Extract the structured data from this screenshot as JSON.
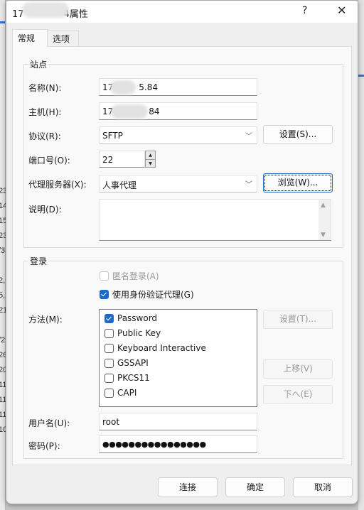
{
  "window": {
    "title_prefix": "17",
    "title_suffix": "4属性",
    "help_label": "?",
    "close_label": "✕"
  },
  "tabs": [
    {
      "label": "常规",
      "active": true
    },
    {
      "label": "选项",
      "active": false
    }
  ],
  "site": {
    "group_label": "站点",
    "name_label": "名称(N):",
    "name_value_prefix": "17",
    "name_value_suffix": "5.84",
    "host_label": "主机(H):",
    "host_value_prefix": "17",
    "host_value_suffix": "84",
    "protocol_label": "协议(R):",
    "protocol_value": "SFTP",
    "protocol_settings_button": "设置(S)...",
    "port_label": "端口号(O):",
    "port_value": "22",
    "proxy_label": "代理服务器(X):",
    "proxy_value": "人事代理",
    "browse_button": "浏览(W)...",
    "description_label": "说明(D):",
    "description_value": ""
  },
  "login": {
    "group_label": "登录",
    "anonymous_label": "匿名登录(A)",
    "anonymous_checked": false,
    "anonymous_disabled": true,
    "agent_label": "使用身份验证代理(G)",
    "agent_checked": true,
    "method_label": "方法(M):",
    "methods": [
      {
        "label": "Password",
        "checked": true
      },
      {
        "label": "Public Key",
        "checked": false
      },
      {
        "label": "Keyboard Interactive",
        "checked": false
      },
      {
        "label": "GSSAPI",
        "checked": false
      },
      {
        "label": "PKCS11",
        "checked": false
      },
      {
        "label": "CAPI",
        "checked": false
      }
    ],
    "method_settings_button": "设置(T)...",
    "move_up_button": "上移(V)",
    "move_down_button": "下へ(E)",
    "username_label": "用户名(U):",
    "username_value": "root",
    "password_label": "密码(P):",
    "password_masked": "●●●●●●●●●●●●●●●●"
  },
  "footer": {
    "connect_button": "连接",
    "ok_button": "确定",
    "cancel_button": "取消"
  },
  "background": {
    "left_fragments": [
      "23",
      "14",
      "15",
      "23",
      "/3",
      "2,",
      "5,",
      "21",
      "/2",
      "26",
      "20",
      "11",
      "11",
      "11",
      "10"
    ]
  },
  "colors": {
    "accent": "#1c6bc7",
    "dialog_bg": "#efefef",
    "panel_bg": "#f9f9f9"
  }
}
